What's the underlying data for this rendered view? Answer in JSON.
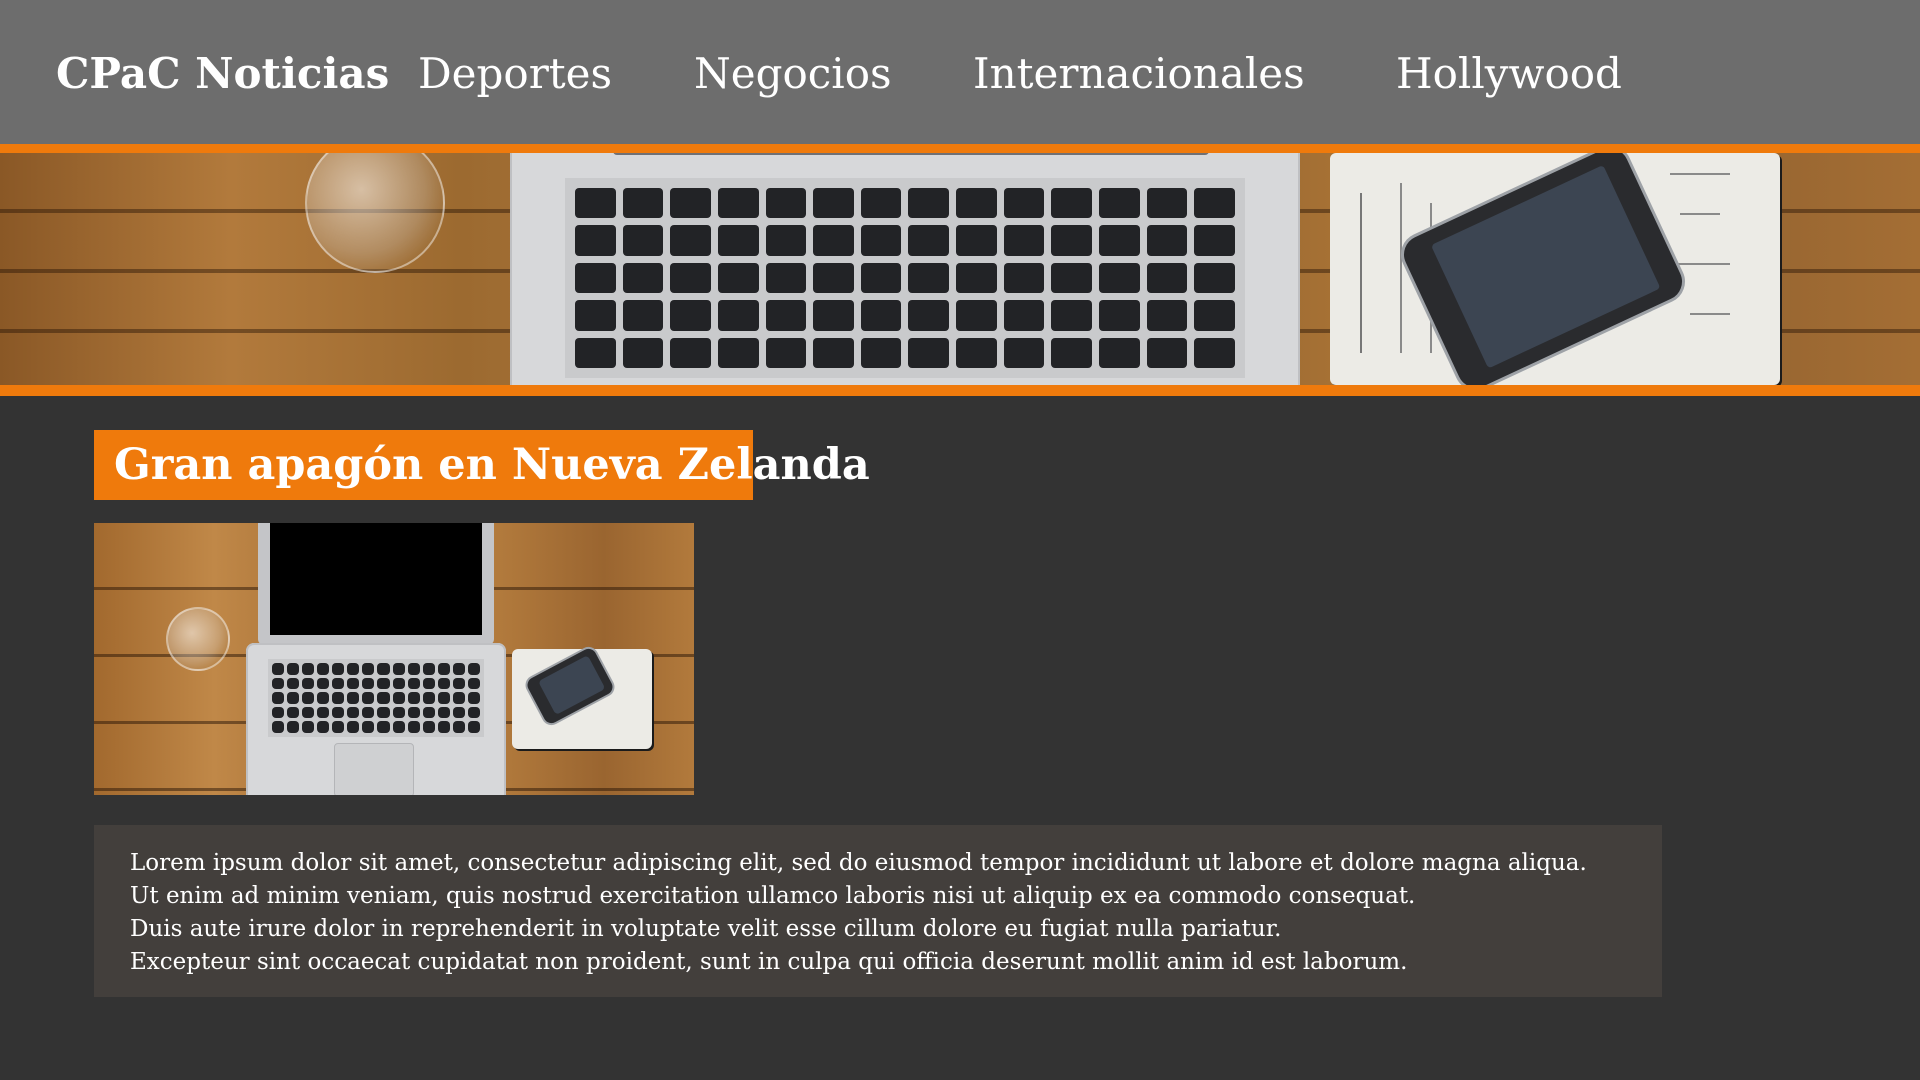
{
  "nav": {
    "brand": "CPaC Noticias",
    "items": [
      {
        "label": "Deportes"
      },
      {
        "label": "Negocios"
      },
      {
        "label": "Internacionales"
      },
      {
        "label": "Hollywood"
      }
    ]
  },
  "colors": {
    "nav_bg": "#6d6d6d",
    "accent": "#ef7a0c",
    "page_bg": "#333333",
    "text_box_bg": "#433f3c"
  },
  "article": {
    "title": "Gran apagón en Nueva Zelanda",
    "paragraph_lines": [
      "Lorem ipsum dolor sit amet, consectetur adipiscing elit, sed do eiusmod tempor  incididunt ut labore et dolore magna aliqua.",
      "Ut enim ad minim veniam, quis nostrud  exercitation ullamco laboris nisi ut aliquip ex ea commodo consequat.",
      "Duis aute irure dolor in reprehenderit in voluptate velit esse cillum dolore eu fugiat nulla pariatur.",
      "Excepteur sint occaecat cupidatat non proident, sunt in culpa qui officia deserunt mollit anim id est laborum."
    ]
  }
}
